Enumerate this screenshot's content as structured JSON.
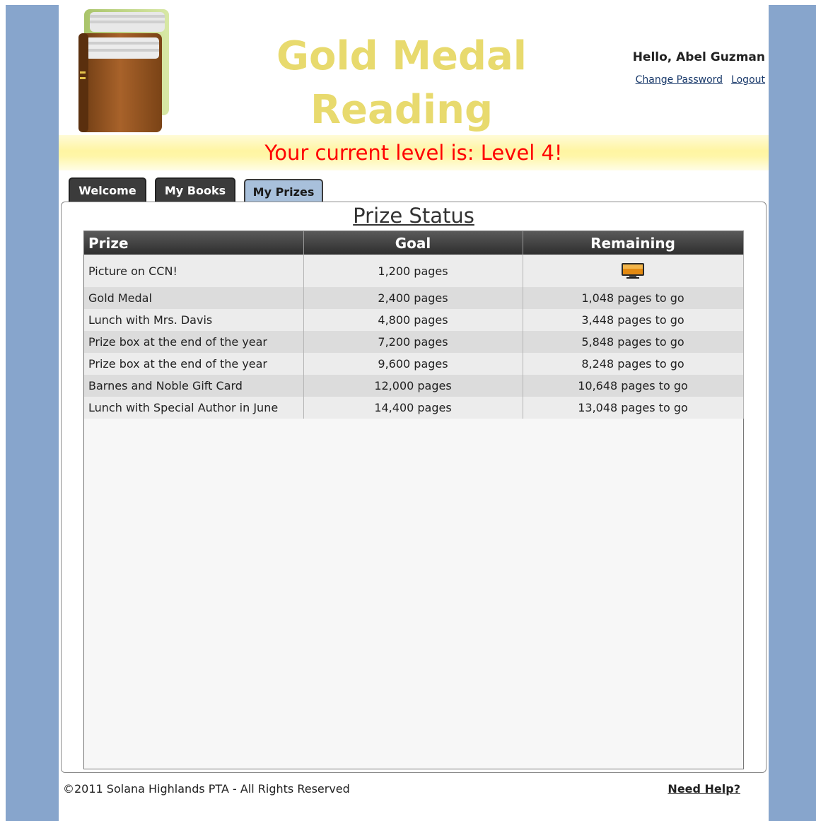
{
  "header": {
    "title_line1": "Gold Medal",
    "title_line2": "Reading",
    "greeting": "Hello, Abel Guzman",
    "change_password": "Change Password",
    "logout": "Logout"
  },
  "level_banner": "Your current level is: Level 4!",
  "tabs": [
    {
      "label": "Welcome",
      "active": false
    },
    {
      "label": "My Books",
      "active": false
    },
    {
      "label": "My Prizes",
      "active": true
    }
  ],
  "main": {
    "section_title": "Prize Status",
    "columns": [
      "Prize",
      "Goal",
      "Remaining"
    ],
    "rows": [
      {
        "prize": "Picture on CCN!",
        "goal": "1,200 pages",
        "remaining": "",
        "remaining_icon": "monitor-icon"
      },
      {
        "prize": "Gold Medal",
        "goal": "2,400 pages",
        "remaining": "1,048 pages to go"
      },
      {
        "prize": "Lunch with Mrs. Davis",
        "goal": "4,800 pages",
        "remaining": "3,448 pages to go"
      },
      {
        "prize": "Prize box at the end of the year",
        "goal": "7,200 pages",
        "remaining": "5,848 pages to go"
      },
      {
        "prize": "Prize box at the end of the year",
        "goal": "9,600 pages",
        "remaining": "8,248 pages to go"
      },
      {
        "prize": "Barnes and Noble Gift Card",
        "goal": "12,000 pages",
        "remaining": "10,648 pages to go"
      },
      {
        "prize": "Lunch with Special Author in June",
        "goal": "14,400 pages",
        "remaining": "13,048 pages to go"
      }
    ]
  },
  "footer": {
    "copyright": "©2011 Solana Highlands PTA - All Rights Reserved",
    "help": "Need Help?"
  },
  "colors": {
    "side_background": "#87a5cc",
    "title_gold": "#e8da6e",
    "level_text": "#ff0000",
    "active_tab": "#a8c0db"
  }
}
